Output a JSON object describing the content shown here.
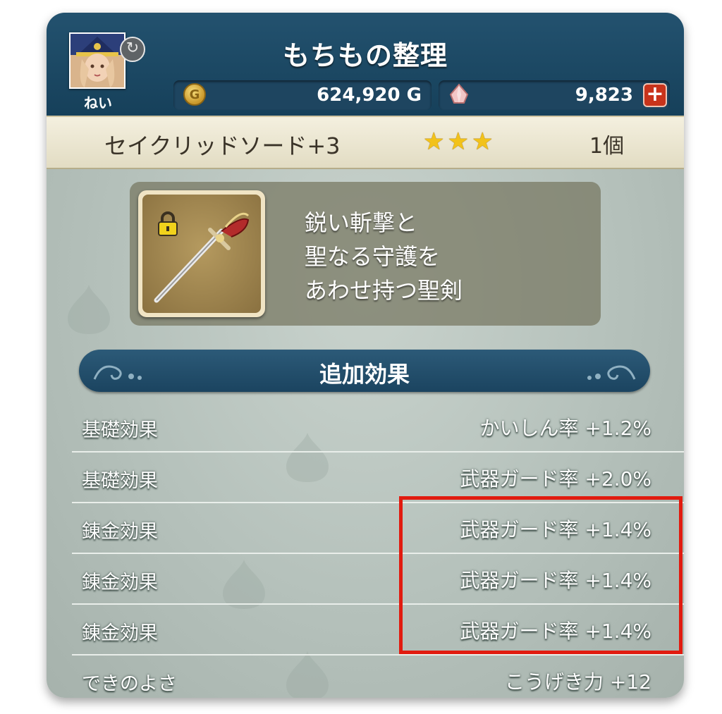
{
  "header": {
    "title": "もちもの整理",
    "player_name": "ねい",
    "gold": "624,920 G",
    "gems": "9,823"
  },
  "item": {
    "name": "セイクリッドソード+3",
    "stars": 3,
    "count": "1個",
    "description": [
      "鋭い斬撃と",
      "聖なる守護を",
      "あわせ持つ聖剣"
    ]
  },
  "effects": {
    "title": "追加効果",
    "rows": [
      {
        "label": "基礎効果",
        "value": "かいしん率 +1.2%"
      },
      {
        "label": "基礎効果",
        "value": "武器ガード率 +2.0%"
      },
      {
        "label": "錬金効果",
        "value": "武器ガード率 +1.4%"
      },
      {
        "label": "錬金効果",
        "value": "武器ガード率 +1.4%"
      },
      {
        "label": "錬金効果",
        "value": "武器ガード率 +1.4%"
      },
      {
        "label": "できのよさ",
        "value": "こうげき力 +12"
      }
    ]
  },
  "icons": {
    "coin": "gold-coin-icon",
    "gem": "gem-icon",
    "plus": "plus-icon",
    "lock": "lock-icon",
    "swap": "swap-character-icon",
    "weapon": "sword-icon"
  },
  "colors": {
    "header": "#1b4862",
    "highlight": "#e11b0f",
    "star": "#f2c21a"
  }
}
